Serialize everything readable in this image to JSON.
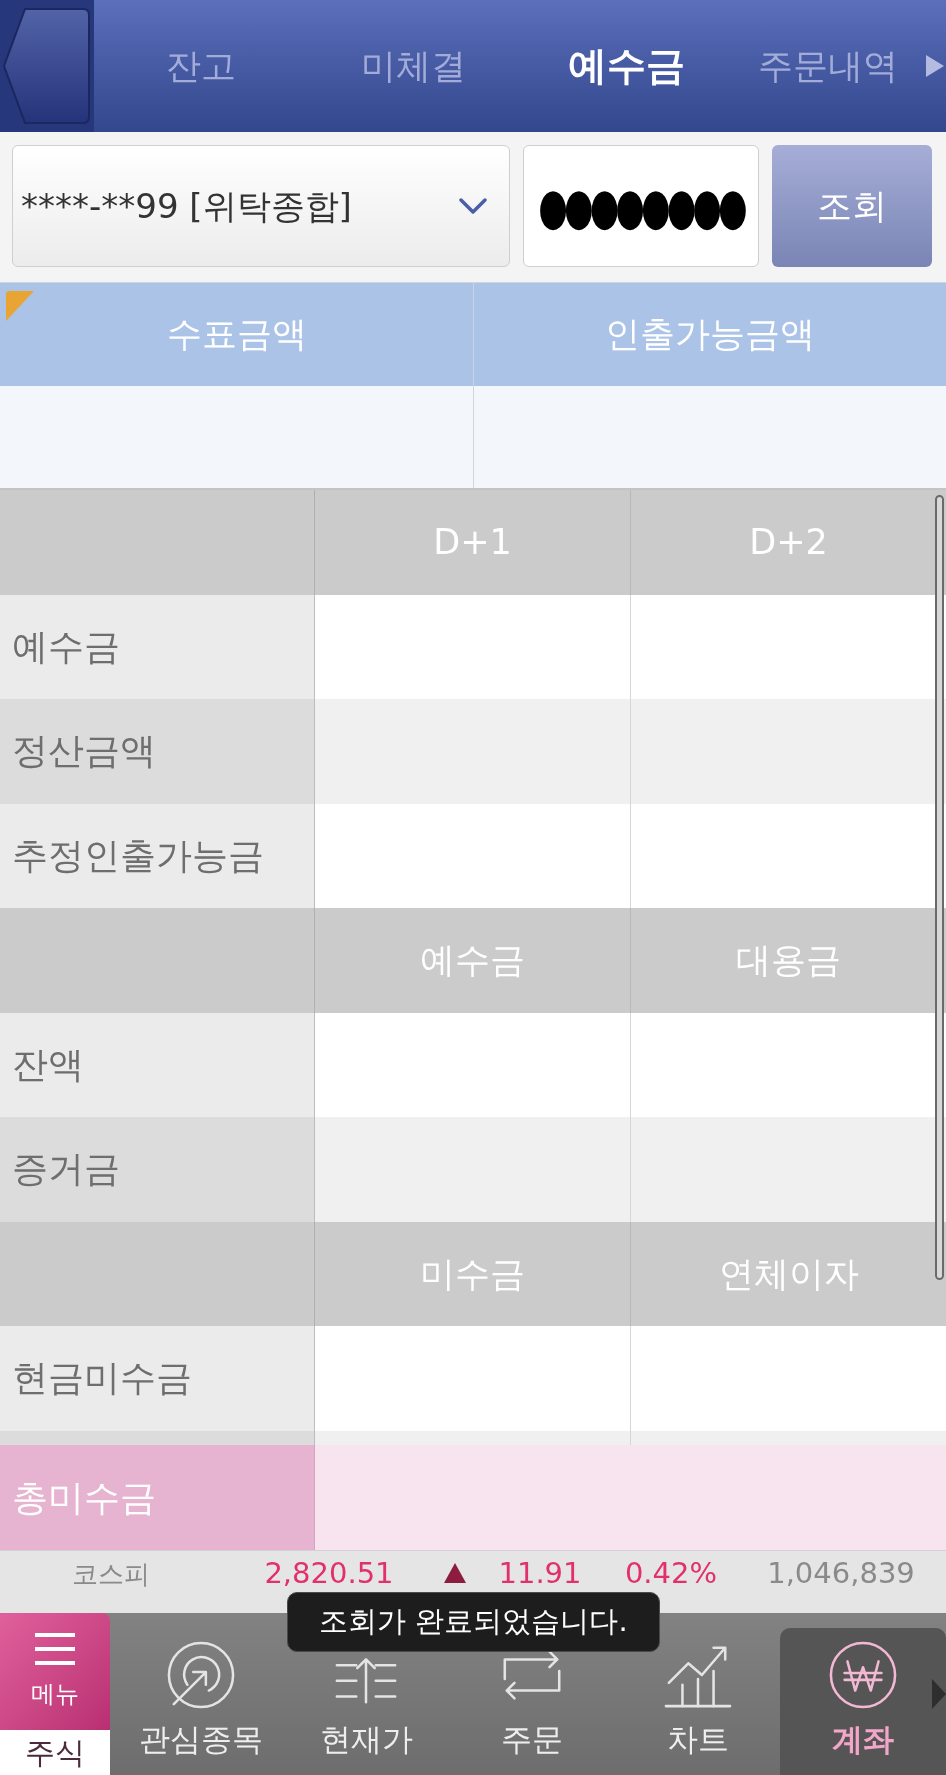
{
  "top_bar": {
    "tabs": [
      {
        "label": "잔고",
        "selected": false
      },
      {
        "label": "미체결",
        "selected": false
      },
      {
        "label": "예수금",
        "selected": true
      },
      {
        "label": "주문내역",
        "selected": false
      }
    ]
  },
  "account": {
    "value": "****-**99 [위탁종합]",
    "password": "●●●●●●●●",
    "search_button": "조회"
  },
  "summary": {
    "columns": [
      "수표금액",
      "인출가능금액"
    ]
  },
  "table": {
    "sections": [
      {
        "columns": [
          "D+1",
          "D+2"
        ],
        "rows": [
          "예수금",
          "정산금액",
          "추정인출가능금"
        ]
      },
      {
        "columns": [
          "예수금",
          "대용금"
        ],
        "rows": [
          "잔액",
          "증거금"
        ]
      },
      {
        "columns": [
          "미수금",
          "연체이자"
        ],
        "rows": [
          "현금미수금"
        ]
      }
    ],
    "total_row": "총미수금"
  },
  "ticker": {
    "name": "코스피",
    "value": "2,820.51",
    "rising": true,
    "change": "11.91",
    "percent": "0.42%",
    "volume": "1,046,839"
  },
  "toast": "조회가 완료되었습니다.",
  "bottom_nav": {
    "menu": "메뉴",
    "category": "주식",
    "items": [
      {
        "label": "관심종목",
        "kind": "watchlist",
        "selected": false
      },
      {
        "label": "현재가",
        "kind": "price",
        "selected": false
      },
      {
        "label": "주문",
        "kind": "order",
        "selected": false
      },
      {
        "label": "차트",
        "kind": "chart",
        "selected": false
      },
      {
        "label": "계좌",
        "kind": "account",
        "selected": true
      }
    ]
  }
}
